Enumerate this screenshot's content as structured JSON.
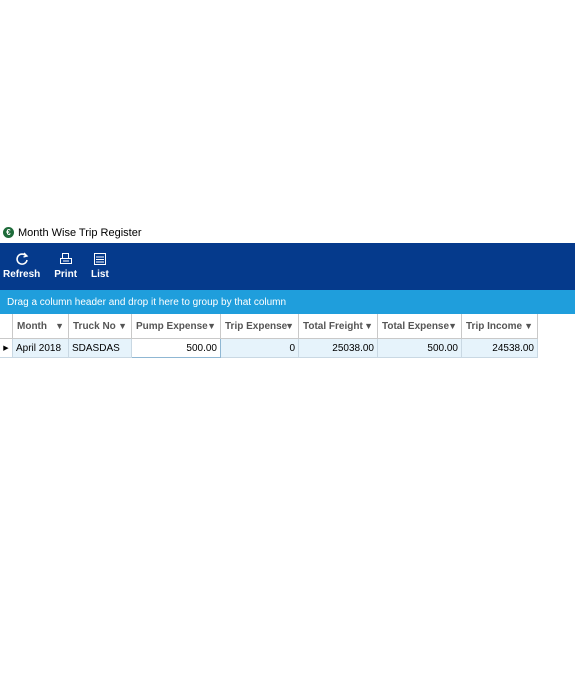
{
  "window": {
    "title": "Month Wise Trip Register",
    "app_icon": "app-logo-icon"
  },
  "toolbar": {
    "buttons": [
      {
        "label": "Refresh",
        "icon": "refresh-icon"
      },
      {
        "label": "Print",
        "icon": "print-icon"
      },
      {
        "label": "List",
        "icon": "list-icon"
      }
    ]
  },
  "grid": {
    "group_hint": "Drag a column header and drop it here to group by that column",
    "columns": [
      "Month",
      "Truck No",
      "Pump Expense",
      "Trip Expense",
      "Total Freight",
      "Total Expense",
      "Trip Income"
    ],
    "rows": [
      [
        "April 2018",
        "SDASDAS",
        "500.00",
        "0",
        "25038.00",
        "500.00",
        "24538.00"
      ]
    ]
  },
  "colors": {
    "ribbon": "#053a8c",
    "group_bar": "#1f9edc",
    "row_bg": "#e6f3fb"
  }
}
